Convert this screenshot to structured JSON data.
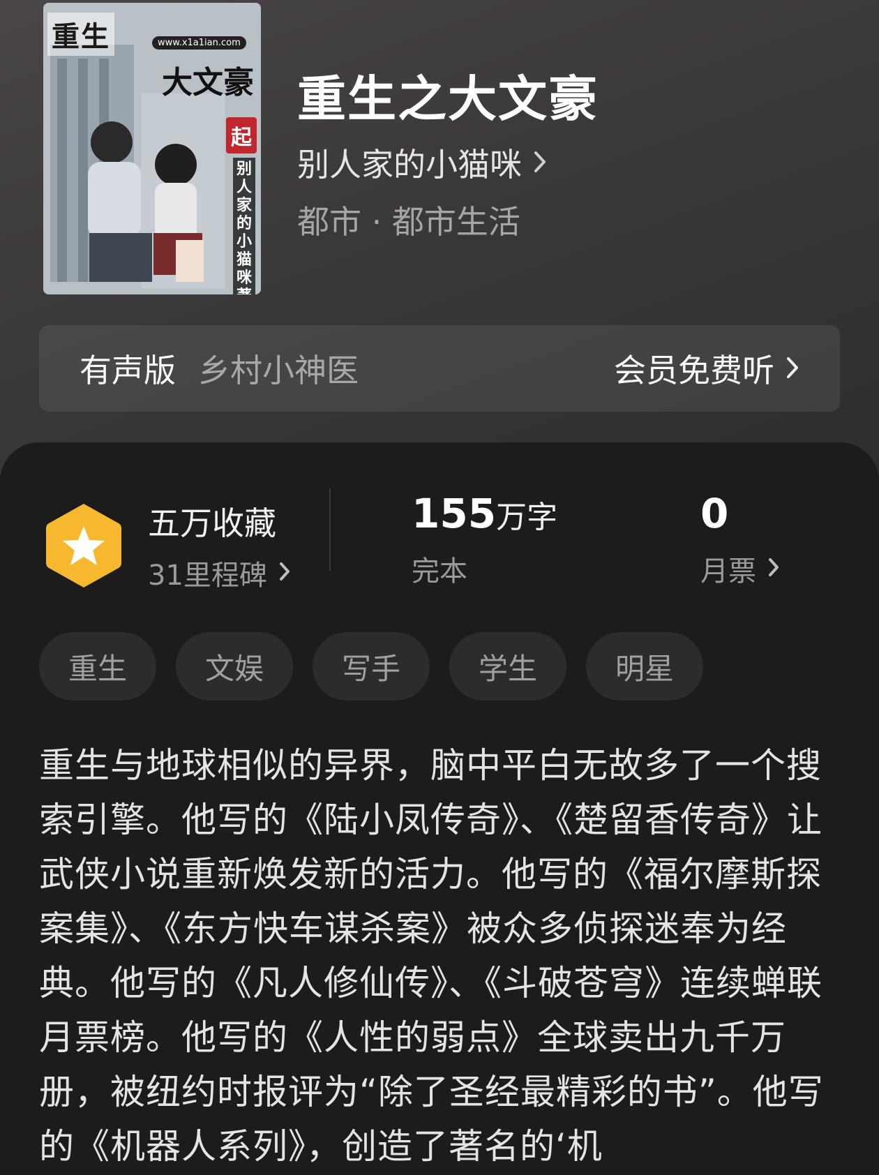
{
  "book": {
    "title": "重生之大文豪",
    "author": "别人家的小猫咪",
    "genre": "都市 · 都市生活",
    "cover": {
      "title_text": "重生",
      "subtitle_text": "大文豪",
      "url_text": "www.x1a1ian.com",
      "badge_text": "起",
      "vertical_text": "别人家的小猫咪著"
    }
  },
  "audio": {
    "label": "有声版",
    "name": "乡村小神医",
    "action": "会员免费听"
  },
  "stats": {
    "favorites": {
      "title": "五万收藏",
      "sub": "31里程碑"
    },
    "words": {
      "number": "155",
      "unit": "万字",
      "label": "完本"
    },
    "votes": {
      "number": "0",
      "label": "月票"
    }
  },
  "tags": [
    "重生",
    "文娱",
    "写手",
    "学生",
    "明星"
  ],
  "description": "重生与地球相似的异界，脑中平白无故多了一个搜索引擎。他写的《陆小凤传奇》、《楚留香传奇》让武侠小说重新焕发新的活力。他写的《福尔摩斯探案集》、《东方快车谋杀案》被众多侦探迷奉为经典。他写的《凡人修仙传》、《斗破苍穹》连续蝉联月票榜。他写的《人性的弱点》全球卖出九千万册，被纽约时报评为“除了圣经最精彩的书”。他写的《机器人系列》，创造了著名的‘机",
  "colors": {
    "background": "#1b1b1b",
    "accent_hex": "#f5b82e",
    "tag_bg": "#2c2c2c"
  },
  "icons": {
    "favorites": "star-hexagon-icon",
    "chevron": "chevron-right-icon"
  }
}
